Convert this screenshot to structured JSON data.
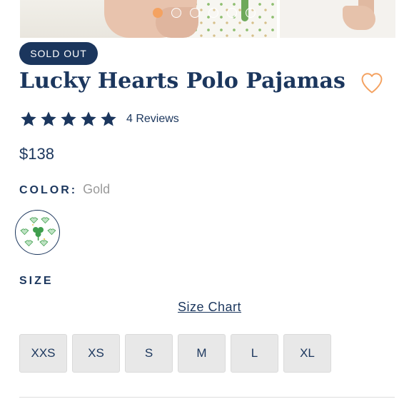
{
  "gallery": {
    "dots": [
      {
        "name": "gallery-dot-1",
        "active": true
      },
      {
        "name": "gallery-dot-2",
        "active": false
      },
      {
        "name": "gallery-dot-3",
        "active": false
      },
      {
        "name": "gallery-dot-4",
        "active": false
      },
      {
        "name": "gallery-dot-5",
        "active": false
      },
      {
        "name": "gallery-dot-6",
        "active": false
      }
    ],
    "active_index": 0
  },
  "product": {
    "badge": "SOLD OUT",
    "title": "Lucky Hearts Polo Pajamas",
    "favorite_icon": "heart-outline-icon",
    "rating": {
      "stars": 5,
      "max": 5,
      "reviews_label": "4 Reviews"
    },
    "price": "$138"
  },
  "color": {
    "label": "COLOR:",
    "value": "Gold",
    "swatch_icon": "shamrock-hearts-pattern-icon"
  },
  "size": {
    "label": "SIZE",
    "chart_link": "Size Chart",
    "options": [
      "XXS",
      "XS",
      "S",
      "M",
      "L",
      "XL"
    ]
  },
  "colors": {
    "primary": "#1b365d",
    "accent": "#f4a261",
    "heart_outline": "#f4a261",
    "muted_text": "#9a9a9a",
    "size_button_bg": "#e8e8e8",
    "shamrock": "#3f9e4d",
    "heart_mint": "#bfe3c4"
  }
}
